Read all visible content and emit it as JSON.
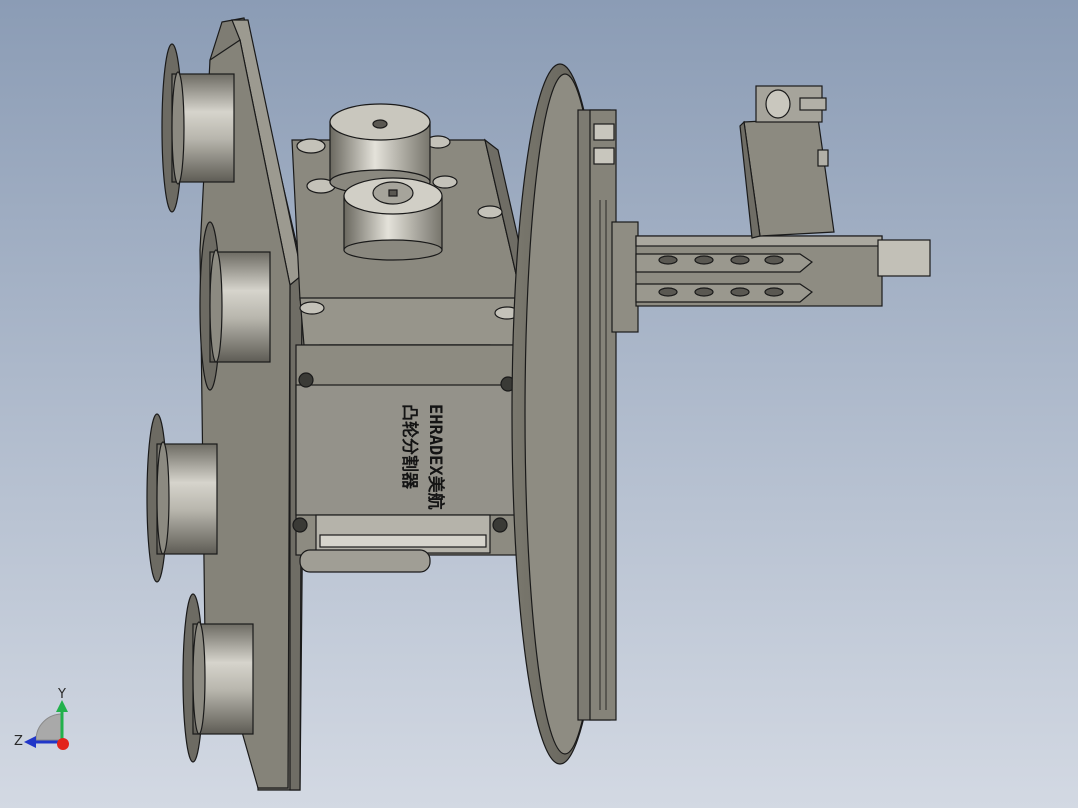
{
  "viewport": {
    "background_top": "#8e9fb7",
    "background_bottom": "#cfd6e1",
    "model_color": "#8f8d83",
    "edge_color": "#1a1a1a"
  },
  "model": {
    "label_line1": "EHRADEX美航",
    "label_line2": "凸轮分割器"
  },
  "triad": {
    "y_label": "Y",
    "z_label": "Z",
    "y_axis_color": "#22b14c",
    "z_axis_color": "#2136c8",
    "x_axis_color": "#e2231a"
  }
}
